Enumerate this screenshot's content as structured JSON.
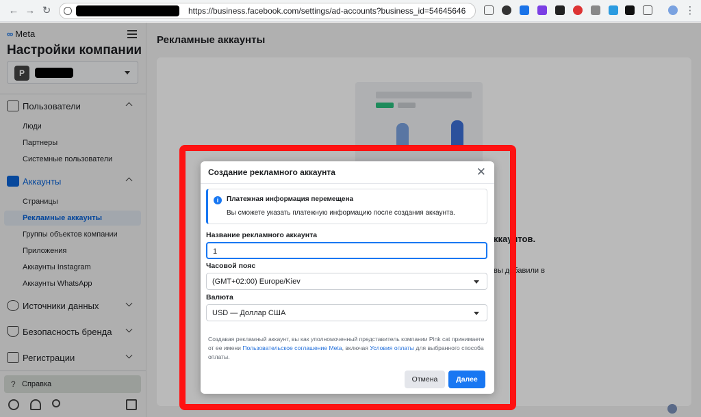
{
  "browser": {
    "url": "https://business.facebook.com/settings/ad-accounts?business_id=54645646"
  },
  "sidebar": {
    "logo": "Meta",
    "title": "Настройки компании",
    "business_avatar": "P",
    "sections": [
      {
        "label": "Пользователи",
        "items": [
          "Люди",
          "Партнеры",
          "Системные пользователи"
        ]
      },
      {
        "label": "Аккаунты",
        "items": [
          "Страницы",
          "Рекламные аккаунты",
          "Группы объектов компании",
          "Приложения",
          "Аккаунты Instagram",
          "Аккаунты WhatsApp"
        ]
      },
      {
        "label": "Источники данных"
      },
      {
        "label": "Безопасность бренда"
      },
      {
        "label": "Регистрации"
      }
    ],
    "help": "Справка"
  },
  "main": {
    "page_title": "Рекламные аккаунты",
    "bg_text_1": "ккаунтов.",
    "bg_text_2": "вы добавили в"
  },
  "modal": {
    "title": "Создание рекламного аккаунта",
    "info_title": "Платежная информация перемещена",
    "info_text": "Вы сможете указать платежную информацию после создания аккаунта.",
    "name_label": "Название рекламного аккаунта",
    "name_value": "1",
    "timezone_label": "Часовой пояс",
    "timezone_value": "(GMT+02:00) Europe/Kiev",
    "currency_label": "Валюта",
    "currency_value": "USD — Доллар США",
    "legal_1": "Создавая рекламный аккаунт, вы как уполномоченный представитель компании Pink cat принимаете от ее имени ",
    "legal_link_1": "Пользовательское соглашение Meta",
    "legal_2": ", включая ",
    "legal_link_2": "Условия оплаты",
    "legal_3": " для выбранного способа оплаты.",
    "cancel": "Отмена",
    "next": "Далее"
  },
  "colors": {
    "accent": "#1877f2",
    "highlight": "#ff1212"
  }
}
